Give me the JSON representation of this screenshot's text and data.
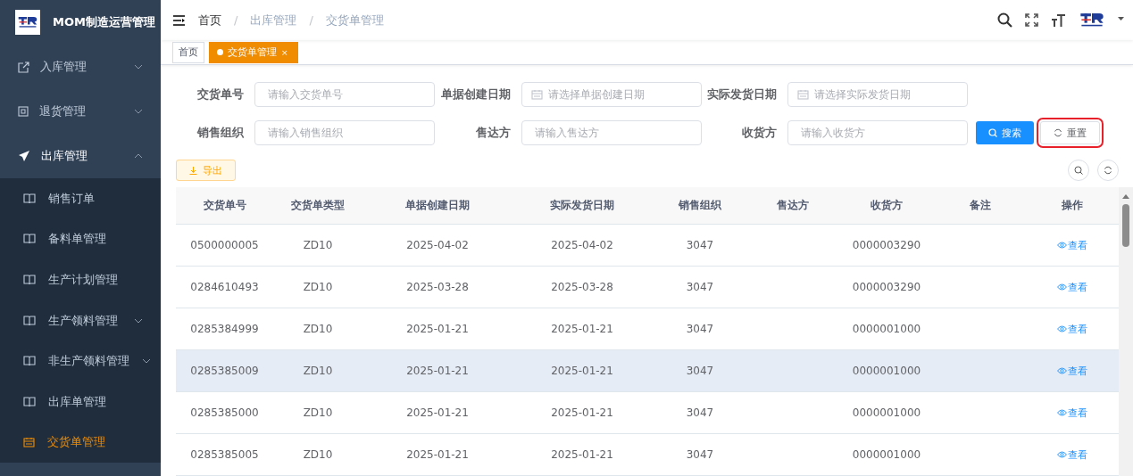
{
  "app": {
    "title": "MOM制造运营管理"
  },
  "menu": [
    {
      "label": "入库管理",
      "expanded": false
    },
    {
      "label": "退货管理",
      "expanded": false
    },
    {
      "label": "出库管理",
      "expanded": true,
      "children": [
        {
          "label": "销售订单",
          "selected": false
        },
        {
          "label": "备料单管理",
          "selected": false
        },
        {
          "label": "生产计划管理",
          "selected": false
        },
        {
          "label": "生产领料管理",
          "selected": false,
          "expanded": false
        },
        {
          "label": "非生产领料管理",
          "selected": false,
          "expanded": false
        },
        {
          "label": "出库单管理",
          "selected": false
        },
        {
          "label": "交货单管理",
          "selected": true
        }
      ]
    }
  ],
  "breadcrumb": [
    "首页",
    "出库管理",
    "交货单管理"
  ],
  "breadcrumb_separator": "/",
  "tabs": [
    {
      "label": "首页",
      "selected": false
    },
    {
      "label": "交货单管理",
      "selected": true,
      "close": "×"
    }
  ],
  "filters": [
    {
      "label": "交货单号",
      "kind": "text",
      "placeholder": "请输入交货单号"
    },
    {
      "label": "单据创建日期",
      "kind": "date",
      "placeholder": "请选择单据创建日期"
    },
    {
      "label": "实际发货日期",
      "kind": "date",
      "placeholder": "请选择实际发货日期"
    },
    {
      "label": "销售组织",
      "kind": "text",
      "placeholder": "请输入销售组织"
    },
    {
      "label": "售达方",
      "kind": "text",
      "placeholder": "请输入售达方"
    },
    {
      "label": "收货方",
      "kind": "text",
      "placeholder": "请输入收货方"
    }
  ],
  "search_button": "搜索",
  "reset_button": {
    "label": "重置",
    "highlighted": true
  },
  "export_button": "导出",
  "table": {
    "columns": [
      "交货单号",
      "交货单类型",
      "单据创建日期",
      "实际发货日期",
      "销售组织",
      "售达方",
      "收货方",
      "备注",
      "操作"
    ],
    "rows": [
      {
        "hovered": false,
        "cells": [
          "0500000005",
          "ZD10",
          "2025-04-02",
          "2025-04-02",
          "3047"
        ],
        "receiver": "0000003290",
        "action": "查看"
      },
      {
        "hovered": false,
        "cells": [
          "0284610493",
          "ZD10",
          "2025-03-28",
          "2025-03-28",
          "3047"
        ],
        "receiver": "0000003290",
        "action": "查看"
      },
      {
        "hovered": false,
        "cells": [
          "0285384999",
          "ZD10",
          "2025-01-21",
          "2025-01-21",
          "3047"
        ],
        "receiver": "0000001000",
        "action": "查看"
      },
      {
        "hovered": true,
        "cells": [
          "0285385009",
          "ZD10",
          "2025-01-21",
          "2025-01-21",
          "3047"
        ],
        "receiver": "0000001000",
        "action": "查看"
      },
      {
        "hovered": false,
        "cells": [
          "0285385000",
          "ZD10",
          "2025-01-21",
          "2025-01-21",
          "3047"
        ],
        "receiver": "0000001000",
        "action": "查看"
      },
      {
        "hovered": false,
        "cells": [
          "0285385005",
          "ZD10",
          "2025-01-21",
          "2025-01-21",
          "3047"
        ],
        "receiver": "0000001000",
        "action": "查看"
      }
    ]
  }
}
